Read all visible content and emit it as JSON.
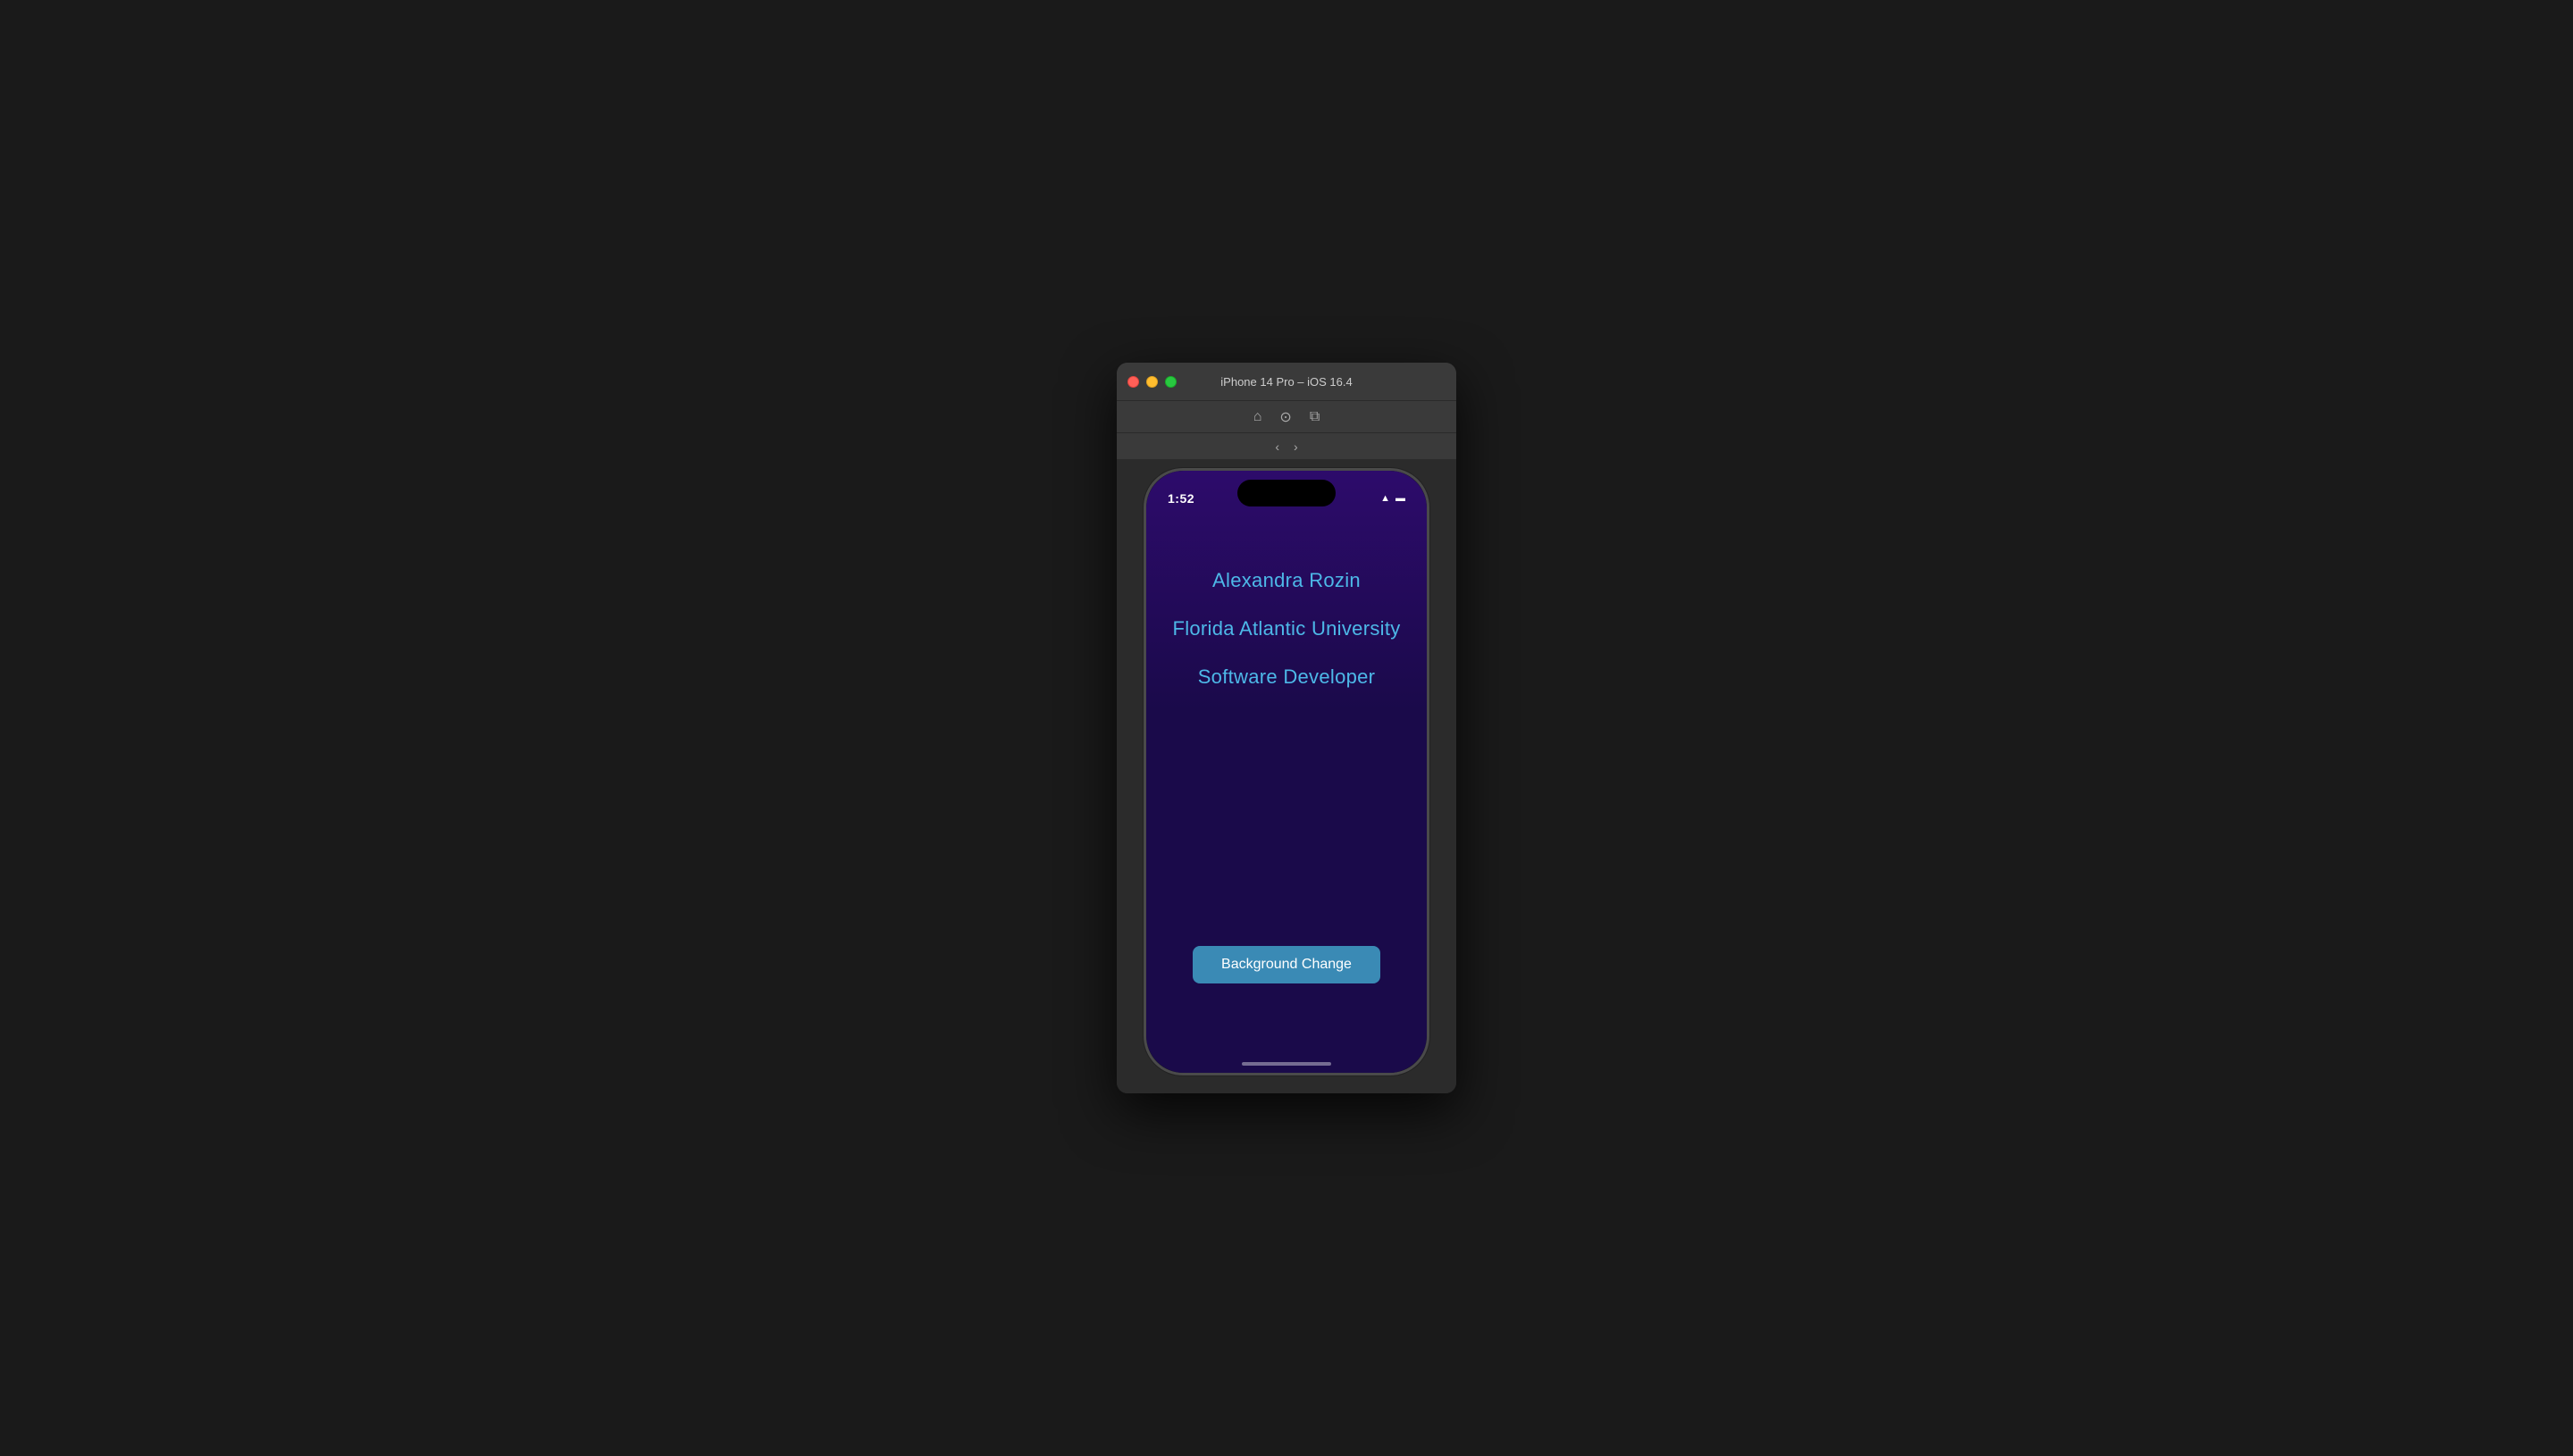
{
  "window": {
    "title": "iPhone 14 Pro – iOS 16.4"
  },
  "phone": {
    "status_time": "1:52",
    "app": {
      "name_label": "Alexandra Rozin",
      "university_label": "Florida Atlantic University",
      "role_label": "Software Developer",
      "button_label": "Background Change"
    }
  },
  "colors": {
    "background": "#1a1a1a",
    "phone_bg": "#2d0b6b",
    "text_color": "#4db8e8",
    "button_bg": "#3a8ab5",
    "button_text": "#ffffff"
  }
}
